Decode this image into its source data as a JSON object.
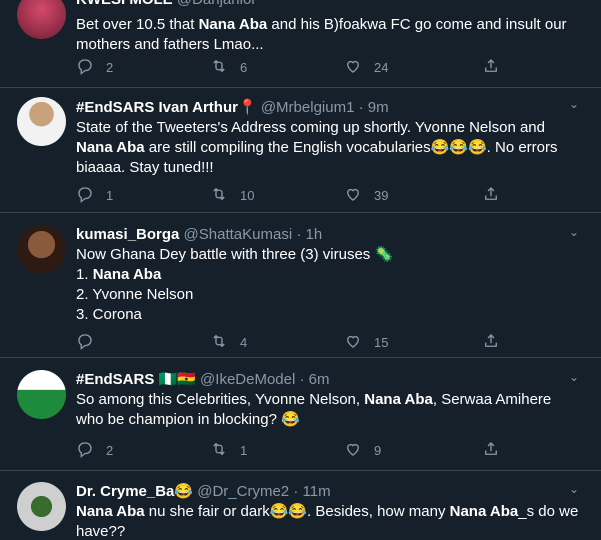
{
  "tweets": [
    {
      "name": "KWESI MOLE",
      "handle": "@Danjanior",
      "time": "",
      "body_parts": [
        {
          "t": "Bet over 10.5 that ",
          "b": false
        },
        {
          "t": "Nana Aba",
          "b": true
        },
        {
          "t": " and his B)foakwa FC go come and insult our mothers and fathers Lmao...",
          "b": false
        }
      ],
      "replies": "2",
      "retweets": "6",
      "likes": "24"
    },
    {
      "name": "#EndSARS Ivan Arthur",
      "handle": "@Mrbelgium1",
      "time": "9m",
      "body_parts": [
        {
          "t": "State of the Tweeters's Address coming up shortly. Yvonne Nelson and ",
          "b": false
        },
        {
          "t": "Nana Aba",
          "b": true
        },
        {
          "t": " are still compiling the English vocabularies😂😂😂. No errors biaaaa. Stay tuned!!!",
          "b": false
        }
      ],
      "replies": "1",
      "retweets": "10",
      "likes": "39"
    },
    {
      "name": "kumasi_Borga",
      "handle": "@ShattaKumasi",
      "time": "1h",
      "body_parts": [
        {
          "t": "Now Ghana Dey battle with three (3) viruses 🦠\n1. ",
          "b": false
        },
        {
          "t": "Nana Aba",
          "b": true
        },
        {
          "t": "\n2. Yvonne Nelson\n3. Corona",
          "b": false
        }
      ],
      "replies": "",
      "retweets": "4",
      "likes": "15"
    },
    {
      "name": "#EndSARS 🇳🇬🇬🇭",
      "handle": "@IkeDeModel",
      "time": "6m",
      "body_parts": [
        {
          "t": "So among this Celebrities, Yvonne Nelson, ",
          "b": false
        },
        {
          "t": "Nana Aba",
          "b": true
        },
        {
          "t": ", Serwaa Amihere who be champion in blocking? 😂",
          "b": false
        }
      ],
      "replies": "2",
      "retweets": "1",
      "likes": "9"
    },
    {
      "name": "Dr. Cryme_Ba😂",
      "handle": "@Dr_Cryme2",
      "time": "11m",
      "body_parts": [
        {
          "t": "Nana Aba",
          "b": true
        },
        {
          "t": " nu she fair or dark😂😂. Besides, how many ",
          "b": false
        },
        {
          "t": "Nana Aba",
          "b": true
        },
        {
          "t": "_s do we have??",
          "b": false
        }
      ],
      "replies": "",
      "retweets": "",
      "likes": ""
    }
  ],
  "colors": {
    "bg": "#15202b",
    "muted": "#8899a6",
    "divider": "#38444d"
  }
}
